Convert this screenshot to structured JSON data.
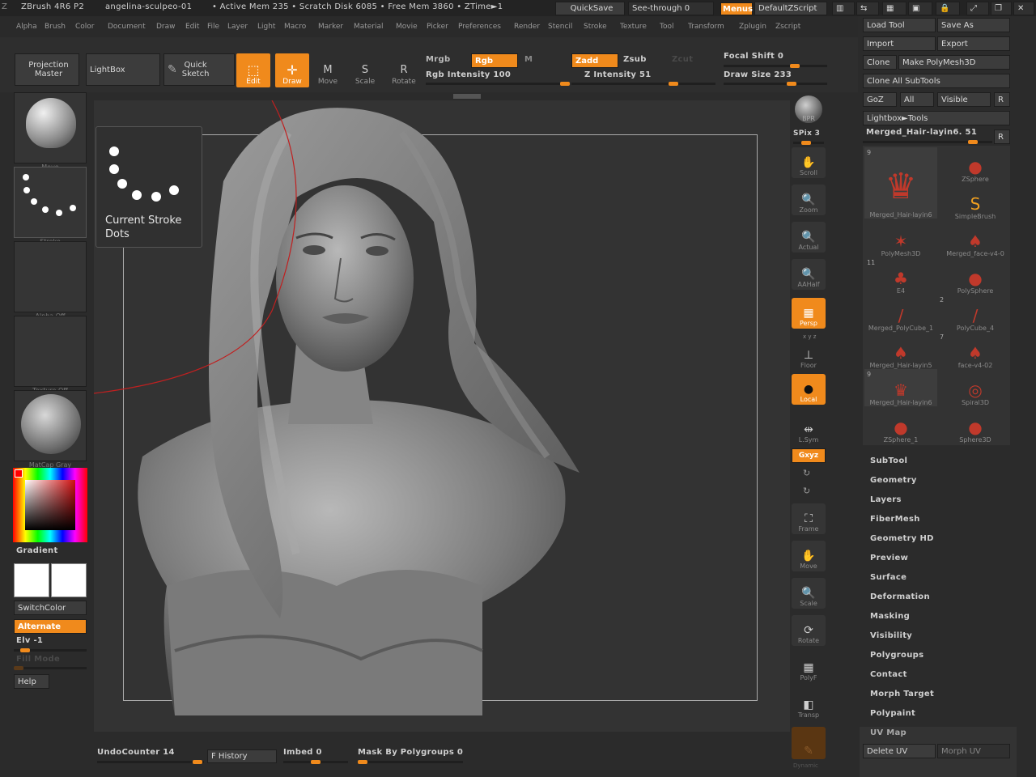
{
  "titlebar": {
    "app": "ZBrush 4R6 P2",
    "doc": "angelina-sculpeo-01",
    "mem": "• Active Mem 235 • Scratch Disk 6085 • Free Mem 3860 • ZTime►1",
    "quicksave": "QuickSave",
    "seethrough": "See-through  0",
    "menus": "Menus",
    "defaultzscript": "DefaultZScript"
  },
  "menus": [
    "Alpha",
    "Brush",
    "Color",
    "Document",
    "Draw",
    "Edit",
    "File",
    "Layer",
    "Light",
    "Macro",
    "Marker",
    "Material",
    "Movie",
    "Picker",
    "Preferences",
    "Render",
    "Stencil",
    "Stroke",
    "Texture",
    "Tool",
    "Transform",
    "Zplugin",
    "Zscript"
  ],
  "toolbar": {
    "projection_master": "Projection\nMaster",
    "lightbox": "LightBox",
    "quick_sketch": "Quick\nSketch",
    "edit": "Edit",
    "draw": "Draw",
    "move": "Move",
    "scale": "Scale",
    "rotate": "Rotate",
    "mrgb": "Mrgb",
    "rgb": "Rgb",
    "m": "M",
    "rgb_intensity": "Rgb  Intensity 100",
    "zadd": "Zadd",
    "zsub": "Zsub",
    "zcut": "Zcut",
    "z_intensity": "Z  Intensity 51",
    "focal_shift": "Focal  Shift 0",
    "draw_size": "Draw  Size 233"
  },
  "left": {
    "brush_cap": "Move",
    "stroke_cap": "Stroke",
    "alpha_cap": "Alpha  Off",
    "texture_cap": "Texture  Off",
    "material_cap": "MatCap  Gray",
    "gradient": "Gradient",
    "switchcolor": "SwitchColor",
    "alternate": "Alternate",
    "elv": "Elv -1",
    "fill_mode": "Fill  Mode",
    "help": "Help"
  },
  "popup": {
    "title": "Current Stroke",
    "name": "Dots"
  },
  "rightbar": {
    "bpr": "BPR",
    "spix": "SPix 3",
    "scroll": "Scroll",
    "zoom": "Zoom",
    "actual": "Actual",
    "aahalf": "AAHalf",
    "persp": "Persp",
    "xyz_axes": "x y z",
    "floor": "Floor",
    "local": "Local",
    "lsym": "L.Sym",
    "xyz": "Gxyz",
    "frame": "Frame",
    "move": "Move",
    "scale": "Scale",
    "rotate": "Rotate",
    "polyf": "PolyF",
    "transp": "Transp",
    "dynamic": "Dynamic"
  },
  "toolpanel": {
    "load_tool": "Load  Tool",
    "save_as": "Save  As",
    "import": "Import",
    "export": "Export",
    "clone": "Clone",
    "make_polymesh": "Make  PolyMesh3D",
    "clone_all": "Clone  All  SubTools",
    "goz": "GoZ",
    "all": "All",
    "visible": "Visible",
    "r": "R",
    "lightbox_tools": "Lightbox►Tools",
    "current_tool": "Merged_Hair-layin6. 51",
    "tools": [
      {
        "label": "Merged_Hair-layin6",
        "badge": "9"
      },
      {
        "label": "ZSphere",
        "badge": ""
      },
      {
        "label": "SimpleBrush",
        "badge": ""
      },
      {
        "label": "PolyMesh3D",
        "badge": ""
      },
      {
        "label": "Merged_face-v4-0",
        "badge": ""
      },
      {
        "label": "E4",
        "badge": "11"
      },
      {
        "label": "PolySphere",
        "badge": ""
      },
      {
        "label": "Merged_PolyCube_1",
        "badge": ""
      },
      {
        "label": "PolyCube_4",
        "badge": "2"
      },
      {
        "label": "Merged_Hair-layin5",
        "badge": ""
      },
      {
        "label": "face-v4-02",
        "badge": "7"
      },
      {
        "label": "Merged_Hair-layin6",
        "badge": "9"
      },
      {
        "label": "Spiral3D",
        "badge": ""
      },
      {
        "label": "ZSphere_1",
        "badge": ""
      },
      {
        "label": "Sphere3D",
        "badge": ""
      }
    ],
    "sections": [
      "SubTool",
      "Geometry",
      "Layers",
      "FiberMesh",
      "Geometry HD",
      "Preview",
      "Surface",
      "Deformation",
      "Masking",
      "Visibility",
      "Polygroups",
      "Contact",
      "Morph Target",
      "Polypaint"
    ],
    "uv_map": "UV  Map",
    "delete_uv": "Delete  UV",
    "morph_uv": "Morph  UV"
  },
  "bottom": {
    "undo": "UndoCounter 14",
    "history": "F History",
    "imbed": "Imbed 0",
    "mask_polygroups": "Mask  By  Polygroups 0"
  }
}
